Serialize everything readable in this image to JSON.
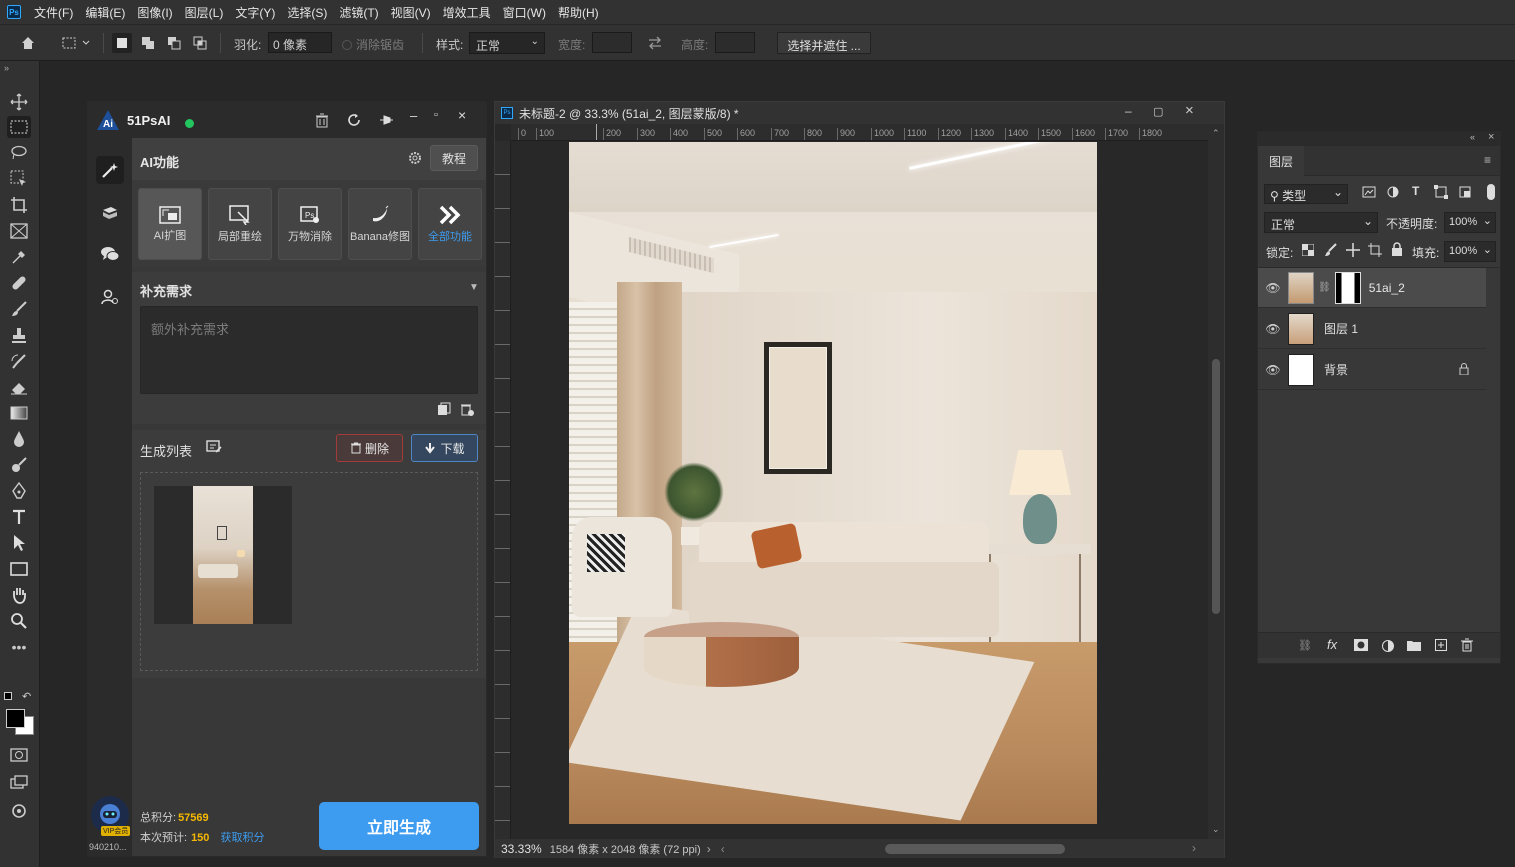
{
  "menubar": {
    "logo": "Ps",
    "items": [
      "文件(F)",
      "编辑(E)",
      "图像(I)",
      "图层(L)",
      "文字(Y)",
      "选择(S)",
      "滤镜(T)",
      "视图(V)",
      "增效工具",
      "窗口(W)",
      "帮助(H)"
    ]
  },
  "options": {
    "feather_label": "羽化:",
    "feather_value": "0 像素",
    "antialias_label": "消除锯齿",
    "style_label": "样式:",
    "style_value": "正常",
    "width_label": "宽度:",
    "height_label": "高度:",
    "select_mask_btn": "选择并遮住 ..."
  },
  "plugin": {
    "title": "51PsAI",
    "status_color": "#22c55e",
    "section_title": "AI功能",
    "tutorial_btn": "教程",
    "features": [
      {
        "label": "AI扩图",
        "icon": "expand-icon"
      },
      {
        "label": "局部重绘",
        "icon": "repaint-icon"
      },
      {
        "label": "万物消除",
        "icon": "erase-icon"
      },
      {
        "label": "Banana修图",
        "icon": "banana-icon"
      },
      {
        "label": "全部功能",
        "icon": "chevrons-right-icon"
      }
    ],
    "supplement_title": "补充需求",
    "supplement_placeholder": "额外补充需求",
    "gen_list_title": "生成列表",
    "delete_btn": "删除",
    "download_btn": "下载",
    "total_points_label": "总积分:",
    "total_points_value": "57569",
    "this_cost_label": "本次预计:",
    "this_cost_value": "150",
    "get_points_link": "获取积分",
    "generate_btn": "立即生成",
    "user_id": "940210...",
    "vip_badge": "VIP会员",
    "accent": "#3d9cf0"
  },
  "document": {
    "tab_title": "未标题-2 @ 33.3% (51ai_2, 图层蒙版/8) *",
    "ruler_top": [
      "0",
      "100",
      "200",
      "300",
      "400",
      "500",
      "600",
      "700",
      "800",
      "900",
      "1000",
      "1100",
      "1200",
      "1300",
      "1400",
      "1500",
      "1600",
      "1700",
      "1800"
    ],
    "zoom": "33.33%",
    "doc_info": "1584 像素 x 2048 像素 (72 ppi)"
  },
  "layers_panel": {
    "tab": "图层",
    "filter_kind": "类型",
    "blend_mode": "正常",
    "opacity_label": "不透明度:",
    "opacity_value": "100%",
    "lock_label": "锁定:",
    "fill_label": "填充:",
    "fill_value": "100%",
    "layers": [
      {
        "name": "51ai_2",
        "selected": true
      },
      {
        "name": "图层 1",
        "selected": false
      },
      {
        "name": "背景",
        "selected": false
      }
    ]
  }
}
